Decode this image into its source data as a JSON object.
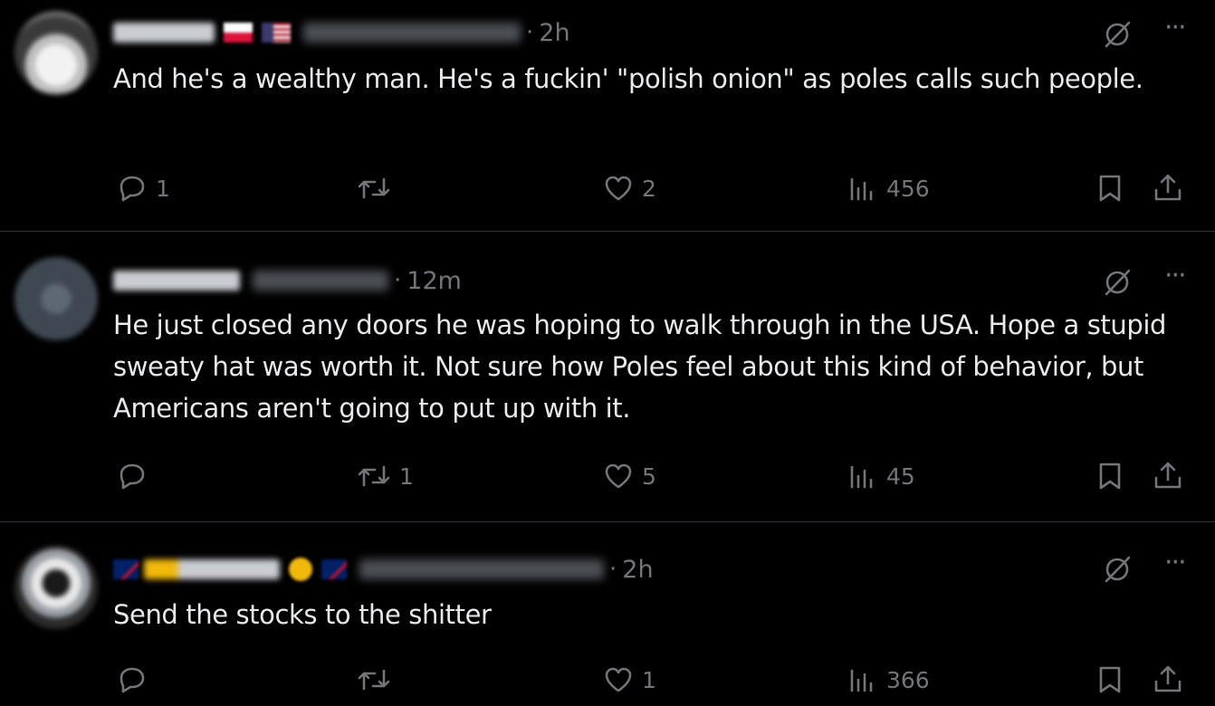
{
  "posts": [
    {
      "time": "2h",
      "text": "And he's a wealthy man. He's a fuckin' \"polish onion\" as poles calls such people.",
      "replies": "1",
      "reposts": "",
      "likes": "2",
      "views": "456"
    },
    {
      "time": "12m",
      "text": "He just closed any doors he was hoping to walk through in the USA. Hope a stupid sweaty hat was worth it. Not sure how Poles feel about this kind of behavior, but Americans aren't going to put up with it.",
      "replies": "",
      "reposts": "1",
      "likes": "5",
      "views": "45"
    },
    {
      "time": "2h",
      "text": "Send the stocks to the shitter",
      "replies": "",
      "reposts": "",
      "likes": "1",
      "views": "366"
    }
  ],
  "separator": "·",
  "colors": {
    "background": "#000000",
    "text": "#e7e9ea",
    "muted": "#71767b",
    "divider": "#2f3336"
  },
  "icons": {
    "reply": "reply-icon",
    "repost": "repost-icon",
    "like": "heart-icon",
    "views": "views-icon",
    "bookmark": "bookmark-icon",
    "share": "share-icon",
    "grok": "grok-icon",
    "more": "more-icon"
  }
}
